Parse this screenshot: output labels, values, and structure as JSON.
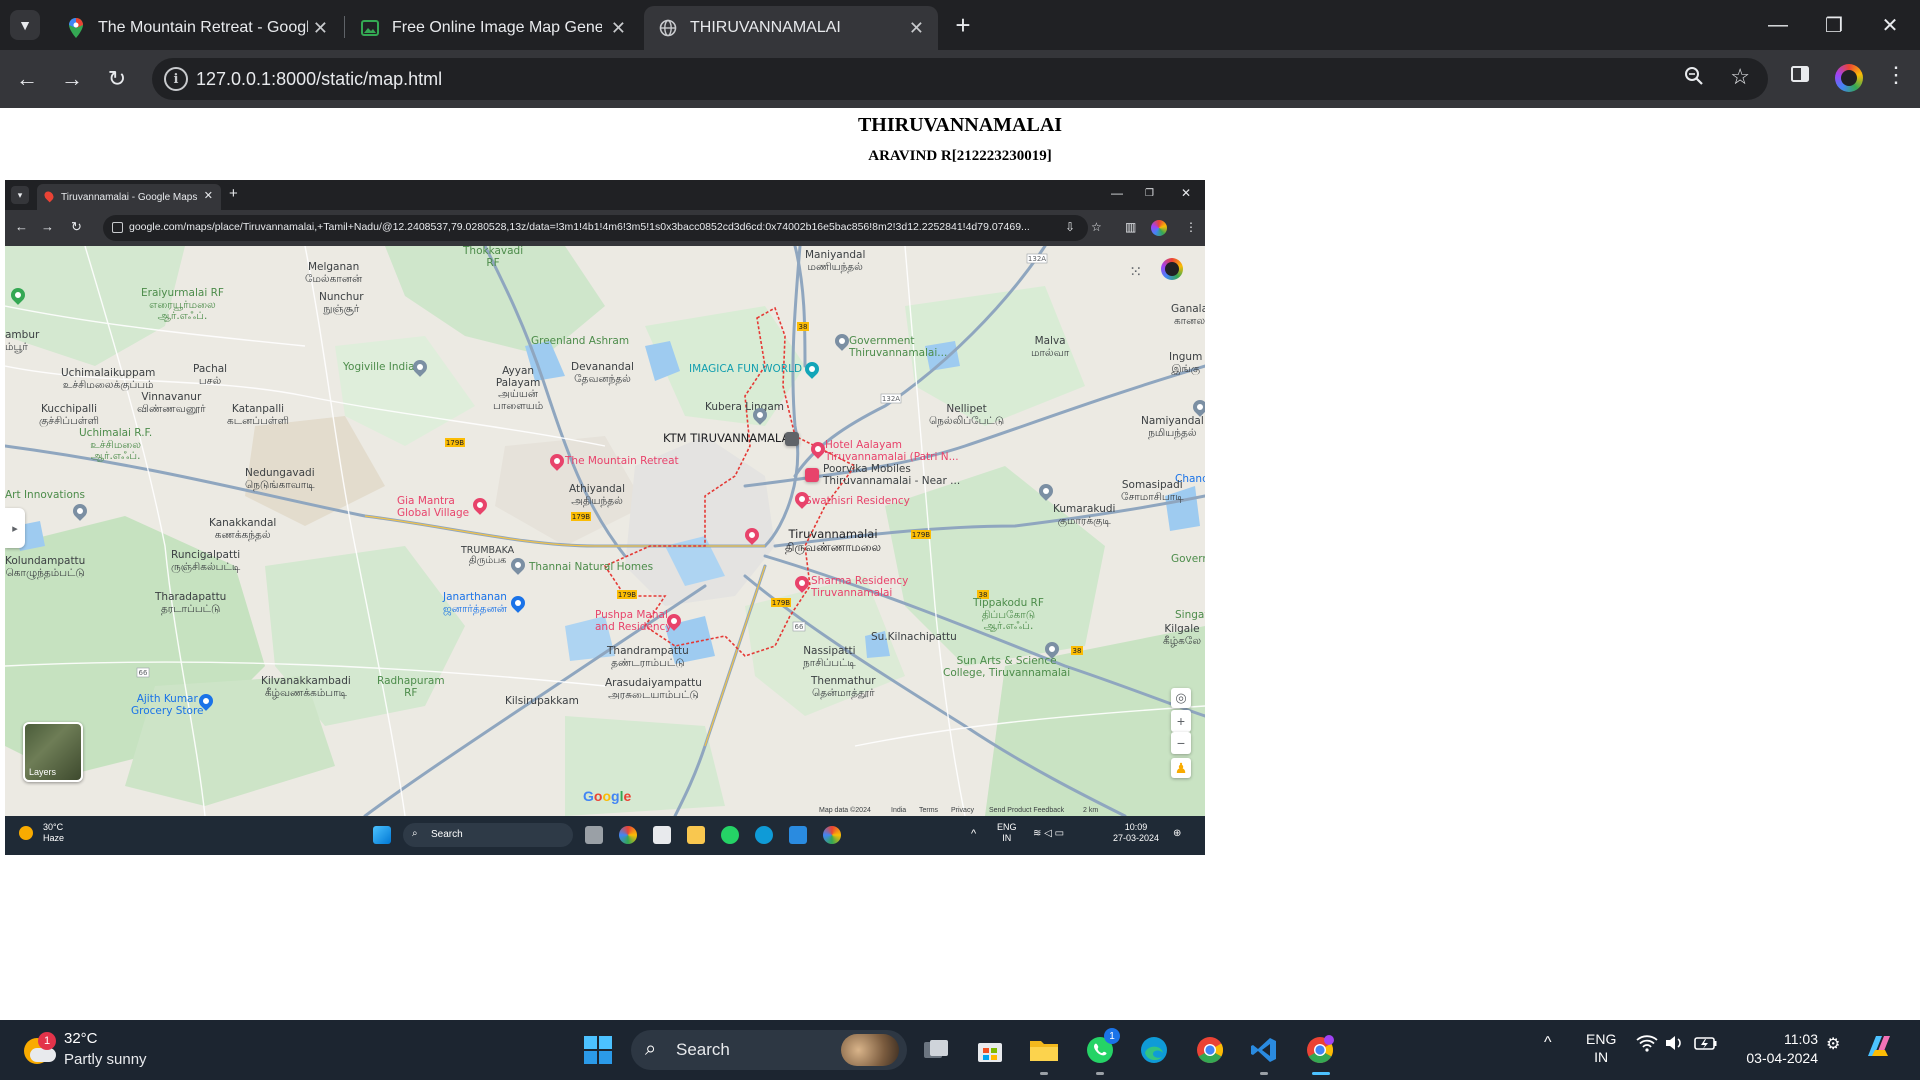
{
  "browser": {
    "tabs": [
      {
        "title": "The Mountain Retreat - Google",
        "active": false
      },
      {
        "title": "Free Online Image Map Genera",
        "active": false
      },
      {
        "title": "THIRUVANNAMALAI",
        "active": true
      }
    ],
    "url": "127.0.0.1:8000/static/map.html",
    "icons": [
      "chevron-down-icon",
      "back-icon",
      "forward-icon",
      "reload-icon",
      "site-info-icon",
      "zoom-icon",
      "bookmark-star-icon",
      "side-panel-icon",
      "menu-icon"
    ]
  },
  "page": {
    "title": "THIRUVANNAMALAI",
    "subtitle": "ARAVIND R[212223230019]"
  },
  "screenshot": {
    "tab_title": "Tiruvannamalai - Google Maps",
    "url": "google.com/maps/place/Tiruvannamalai,+Tamil+Nadu/@12.2408537,79.0280528,13z/data=!3m1!4b1!4m6!3m5!1s0x3bacc0852cd3d6cd:0x74002b16e5bac856!8m2!3d12.2252841!4d79.07469...",
    "map_labels": {
      "melganan": "Melganan\nமேல்கானன்",
      "thokkavadi": "Thokkavadi\nRF",
      "maniyandal": "Maniyandal\nமணியந்தல்",
      "eraiyurmalai": "Eraiyurmalai RF\nஎரையூர்மலை\nஆர்.எஃப்.",
      "nunchur": "Nunchur\nநுஞ்சூர்",
      "ambur": "ambur\nம்பூர்",
      "ganala": "Ganala\nகானல",
      "greenland": "Greenland Ashram",
      "government": "Government\nThiruvannamalai...",
      "malva": "Malva\nமால்வா",
      "uchimalaikuppam": "Uchimalaikuppam\nஉச்சிமலைக்குப்பம்",
      "pachal": "Pachal\nபசல்",
      "yogiville": "Yogiville India",
      "ayyan": "Ayyan\nPalayam\nஅய்யன்\nபாளையம்",
      "devanandal": "Devanandal\nதேவனந்தல்",
      "imagica": "IMAGICA FUN WORLD",
      "ingum": "Ingum\nஇங்கு",
      "vinnavanur": "Vinnavanur\nவிண்ணவனூர்",
      "kubera": "Kubera Lingam",
      "nellipet": "Nellipet\nநெல்லிப்பேட்டு",
      "kucchipalli": "Kucchipalli\nகுச்சிப்பள்ளி",
      "katanpalli": "Katanpalli\nகடனப்பள்ளி",
      "ktm": "KTM TIRUVANNAMALAI",
      "namiyandal": "Namiyandal\nநமியந்தல்",
      "uchimalai_rf": "Uchimalai R.F.\nஉச்சிமலை\nஆர்.எஃப்.",
      "hotel": "Hotel Aalayam\nTiruvannamalai (Patri N...",
      "mountain": "The Mountain Retreat",
      "nedungavadi": "Nedungavadi\nநெடுங்காவாடி",
      "poorvika": "Poorvika Mobiles\nThiruvannamalai - Near ...",
      "chand": "Chand",
      "art": "Art Innovations",
      "athiyandal": "Athiyandal\nஅதியந்தல்",
      "gia": "Gia Mantra\nGlobal Village",
      "swathisri": "Swathisri Residency",
      "somasipadi": "Somasipadi\nசோமாசிபாடி",
      "kumarakudi": "Kumarakudi\nகுமாரக்குடி",
      "kanakkandal": "Kanakkandal\nகணக்கந்தல்",
      "tiruvannamalai": "Tiruvannamalai\nதிருவண்ணாமலை",
      "trumbaka": "TRUMBAKA\nதிரும்பக",
      "kolundampattu": "Kolundampattu\nகொழுந்தம்பட்டு",
      "runcigalpatti": "Runcigalpatti\nருஞ்சிகல்பட்டி",
      "thannai": "Thannai Natural Homes",
      "governm": "Governm",
      "sharma": "Sharma Residency\nTiruvannamalai",
      "janarthanan": "Janarthanan\nஜனார்த்தனன்",
      "tharadapattu": "Tharadapattu\nதரடாப்பட்டு",
      "tippakodu": "Tippakodu RF\nதிப்பகோடு\nஆர்.எஃப்.",
      "singav": "Singav",
      "pushpa": "Pushpa Mahal\nand Residency",
      "kilgale": "Kilgale\nகீழ்கலே",
      "sukilnachipattu": "Su.Kilnachipattu",
      "thandrampattu": "Thandrampattu\nதண்டராம்பட்டு",
      "nassipatti": "Nassipatti\nநாசிப்பட்டி",
      "sunarts": "Sun Arts & Science\nCollege, Tiruvannamalai",
      "kilvanakkambadi": "Kilvanakkambadi\nகீழ்வணக்கம்பாடி",
      "radhapuram": "Radhapuram\nRF",
      "arasudaiyampattu": "Arasudaiyampattu\nஅரசுடையாம்பட்டு",
      "thenmathur": "Thenmathur\nதென்மாத்தூர்",
      "ajith": "Ajith Kumar\nGrocery Store",
      "kilsirupakkam": "Kilsirupakkam"
    },
    "layers_label": "Layers",
    "google_logo": "Google",
    "footer": [
      "Map data ©2024",
      "India",
      "Terms",
      "Privacy",
      "Send Product Feedback",
      "2 km"
    ],
    "taskbar": {
      "temp": "30°C",
      "weather": "Haze",
      "search": "Search",
      "lang1": "ENG",
      "lang2": "IN",
      "time": "10:09",
      "date": "27-03-2024"
    }
  },
  "taskbar": {
    "temp": "32°C",
    "weather": "Partly sunny",
    "weather_badge": "1",
    "search": "Search",
    "whatsapp_badge": "1",
    "lang1": "ENG",
    "lang2": "IN",
    "time": "11:03",
    "date": "03-04-2024"
  },
  "colors": {
    "chrome_dark": "#202124",
    "chrome_toolbar": "#35363a",
    "map_pin_red": "#e8436b",
    "city_boundary": "#e53935",
    "water": "#9ecbf0",
    "park": "#c8e6c9",
    "taskbar": "#1c2530"
  }
}
